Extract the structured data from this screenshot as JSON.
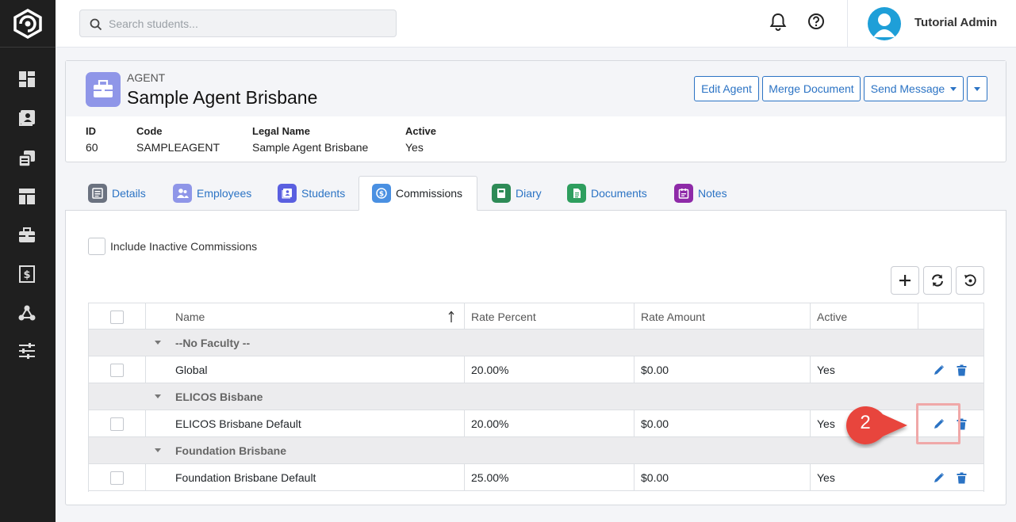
{
  "search": {
    "placeholder": "Search students..."
  },
  "user": {
    "name": "Tutorial Admin"
  },
  "agent": {
    "kicker": "AGENT",
    "title": "Sample Agent Brisbane",
    "buttons": {
      "edit": "Edit Agent",
      "merge": "Merge Document",
      "send": "Send Message"
    },
    "meta": [
      {
        "label": "ID",
        "value": "60"
      },
      {
        "label": "Code",
        "value": "SAMPLEAGENT"
      },
      {
        "label": "Legal Name",
        "value": "Sample Agent Brisbane"
      },
      {
        "label": "Active",
        "value": "Yes"
      }
    ]
  },
  "tabs": [
    {
      "label": "Details",
      "icon": "details-icon",
      "color": "#6b7280"
    },
    {
      "label": "Employees",
      "icon": "employees-icon",
      "color": "#8f96e8"
    },
    {
      "label": "Students",
      "icon": "students-icon",
      "color": "#5a5fe0"
    },
    {
      "label": "Commissions",
      "icon": "commissions-icon",
      "color": "#4a90e2"
    },
    {
      "label": "Diary",
      "icon": "diary-icon",
      "color": "#2e8b57"
    },
    {
      "label": "Documents",
      "icon": "documents-icon",
      "color": "#2e9e5e"
    },
    {
      "label": "Notes",
      "icon": "notes-icon",
      "color": "#8e2aa8"
    }
  ],
  "commissions": {
    "include_inactive_label": "Include Inactive Commissions",
    "columns": [
      "Name",
      "Rate Percent",
      "Rate Amount",
      "Active"
    ],
    "groups": [
      {
        "name": "--No Faculty --",
        "rows": [
          {
            "name": "Global",
            "rate_percent": "20.00%",
            "rate_amount": "$0.00",
            "active": "Yes"
          }
        ]
      },
      {
        "name": "ELICOS Bisbane",
        "rows": [
          {
            "name": "ELICOS Brisbane Default",
            "rate_percent": "20.00%",
            "rate_amount": "$0.00",
            "active": "Yes"
          }
        ]
      },
      {
        "name": "Foundation Brisbane",
        "rows": [
          {
            "name": "Foundation Brisbane Default",
            "rate_percent": "25.00%",
            "rate_amount": "$0.00",
            "active": "Yes"
          }
        ]
      }
    ]
  },
  "callout": {
    "number": "2",
    "color": "#e8453c"
  },
  "colors": {
    "accent": "#2b73c4",
    "sidebar": "#1f1f1f",
    "avatar": "#1e9fd8"
  }
}
